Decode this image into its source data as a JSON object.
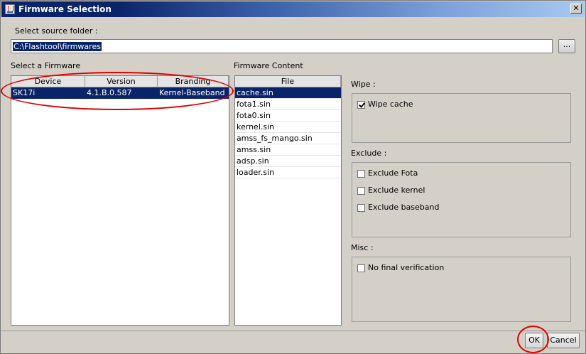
{
  "window": {
    "title": "Firmware Selection"
  },
  "source": {
    "label": "Select source folder :",
    "path": "C:\\Flashtool\\firmwares",
    "browse_label": "..."
  },
  "firmware_list": {
    "label": "Select a Firmware",
    "columns": [
      "Device",
      "Version",
      "Branding"
    ],
    "rows": [
      {
        "device": "SK17i",
        "version": "4.1.B.0.587",
        "branding": "Kernel-Baseband"
      }
    ]
  },
  "content": {
    "label": "Firmware Content",
    "column": "File",
    "files": [
      "cache.sin",
      "fota1.sin",
      "fota0.sin",
      "kernel.sin",
      "amss_fs_mango.sin",
      "amss.sin",
      "adsp.sin",
      "loader.sin"
    ]
  },
  "wipe": {
    "label": "Wipe :",
    "options": [
      {
        "label": "Wipe cache",
        "checked": true
      }
    ]
  },
  "exclude": {
    "label": "Exclude :",
    "options": [
      {
        "label": "Exclude Fota",
        "checked": false
      },
      {
        "label": "Exclude kernel",
        "checked": false
      },
      {
        "label": "Exclude baseband",
        "checked": false
      }
    ]
  },
  "misc": {
    "label": "Misc :",
    "options": [
      {
        "label": "No final verification",
        "checked": false
      }
    ]
  },
  "buttons": {
    "ok": "OK",
    "cancel": "Cancel"
  },
  "colors": {
    "selection": "#0a246a",
    "highlight": "#e00000"
  }
}
